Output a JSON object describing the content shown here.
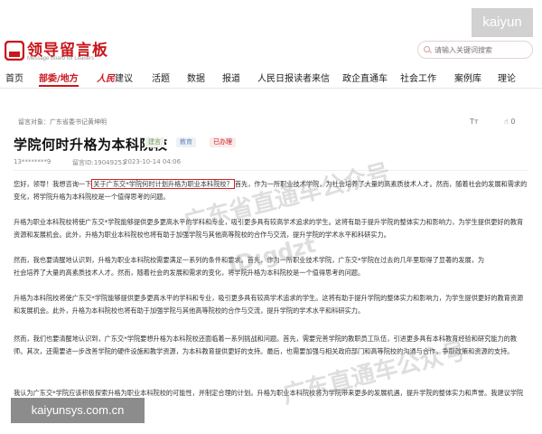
{
  "watermark_corner": "kaiyun",
  "header": {
    "logo_title": "领导留言板",
    "logo_subtitle": "Message Board for Leaders",
    "search_placeholder": "请输入关键词搜索"
  },
  "nav": {
    "items": [
      "首页",
      "部委/地方",
      "人民建议",
      "活题",
      "数据",
      "报道",
      "人民日报读者来信",
      "政企直通车",
      "社会工作",
      "案例库",
      "理论"
    ],
    "active_index": 1,
    "brand_prefix": "人民",
    "brand_suffix": "建议"
  },
  "article": {
    "message_to": "留言对象：广东省委书记黄坤明",
    "font_size_label": "Tт",
    "likes": "0",
    "title": "学院何时升格为本科院校",
    "tags": [
      "建言",
      "教育",
      "已办理"
    ],
    "author": "13********9",
    "message_id": "留言ID:19049253",
    "date": "2023-10-14 04:06",
    "p1_pre": "您好，领导！我想咨询一下",
    "p1_highlight": "关于广东交*学院何时计划升格为职业本科院校？",
    "p1_post": "首先，作为一所职业技术学院，为社会培养了大量的高素质技术人才。然而，随着社会的发展和需求的",
    "p1_line2": "变化，将学院升格为本科院校是一个值得思考的问题。",
    "p2_line1": "升格为职业本科院校将使广东交*学院能够提供更多更高水平的学科和专业，吸引更多具有较高学术追求的学生。这将有助于提升学院的整体实力和影响力，为学生提供更好的教育",
    "p2_line2": "资源和发展机会。此外，升格为职业本科院校也将有助于加强学院与其他高等院校的合作与交流，提升学院的学术水平和科研实力。",
    "p3_line1": "然而，我也要清醒地认识到，升格为职业本科院校需要满足一系列的条件和要求。首先，作为一所职业技术学院，广东交*学院在过去的几年里取得了显著的发展，为",
    "p3_line2": "社会培养了大量的高素质技术人才。然而，随着社会的发展和需求的变化，将学院升格为本科院校是一个值得思考的问题。",
    "p4_line1": "升格为本科院校将使广东交*学院能够提供更多更高水平的学科和专业，吸引更多具有较高学术追求的学生。这将有助于提升学院的整体实力和影响力，为学生提供更好的教育资源",
    "p4_line2": "和发展机会。此外，升格为本科院校也将有助于加强学院与其他高等院校的合作与交流，提升学院的学术水平和科研实力。",
    "p5_line1": "然而，我们也要清醒地认识到，广东交*学院要想升格为本科院校还面临着一系列挑战和问题。首先，需要完善学院的教职员工队伍，引进更多具有本科教育经验和研究能力的教",
    "p5_line2": "师。其次，还需要进一步改善学院的硬件设施和教学资源，为本科教育提供更好的支持。最后，也需要加强与相关政府部门和高等院校的沟通与合作，争取政策和资源的支持。",
    "p6_line1": "我认为广东交*学院应该积极探索升格为职业本科院校的可能性，并制定合理的计划。升格为职业本科院校将为学院带来更多的发展机遇，提升学院的整体实力和声誉。我建议学院"
  },
  "watermarks": [
    "广东省直通车公众号",
    "ID:gdzt",
    "广东直通车公众号"
  ],
  "bottom_watermark": "kaiyunsys.com.cn"
}
